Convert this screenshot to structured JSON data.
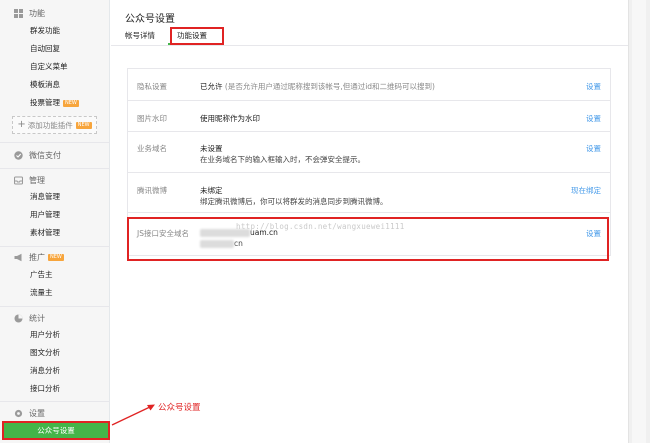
{
  "sidebar": {
    "features": {
      "title": "功能",
      "items": [
        "群发功能",
        "自动回复",
        "自定义菜单",
        "模板消息",
        "投票管理"
      ],
      "new_badge": "NEW",
      "add_plugin": "添加功能插件",
      "add_plugin_badge": "NEW"
    },
    "wechat_pay": {
      "title": "微信支付"
    },
    "manage": {
      "title": "管理",
      "items": [
        "消息管理",
        "用户管理",
        "素材管理"
      ]
    },
    "promote": {
      "title": "推广",
      "badge": "NEW",
      "items": [
        "广告主",
        "流量主"
      ]
    },
    "stats": {
      "title": "统计",
      "items": [
        "用户分析",
        "图文分析",
        "消息分析",
        "接口分析"
      ]
    },
    "settings": {
      "title": "设置",
      "active_item": "公众号设置"
    }
  },
  "main": {
    "page_title": "公众号设置",
    "tabs": [
      {
        "label": "帐号详情"
      },
      {
        "label": "功能设置"
      }
    ],
    "rows": [
      {
        "label": "隐私设置",
        "value": "已允许",
        "desc": "(是否允许用户通过昵称搜到该帐号,但通过id和二维码可以搜到)",
        "action": "设置"
      },
      {
        "label": "图片水印",
        "value": "使用昵称作为水印",
        "action": "设置"
      },
      {
        "label": "业务域名",
        "value": "未设置",
        "sub": "在业务域名下的输入框输入时，不会弹安全提示。",
        "action": "设置"
      },
      {
        "label": "腾讯微博",
        "value": "未绑定",
        "sub": "绑定腾讯微博后，你可以将群发的消息同步到腾讯微博。",
        "action": "现在绑定"
      },
      {
        "label": "JS接口安全域名",
        "value_suffix": "uam.cn",
        "sub_suffix": "cn",
        "action": "设置"
      }
    ]
  },
  "watermark": "http://blog.csdn.net/wangxuewei1111",
  "annotation": {
    "text": "公众号设置"
  },
  "colors": {
    "accent_green": "#44b549",
    "link_blue": "#459ae9",
    "annot_red": "#e02323"
  }
}
